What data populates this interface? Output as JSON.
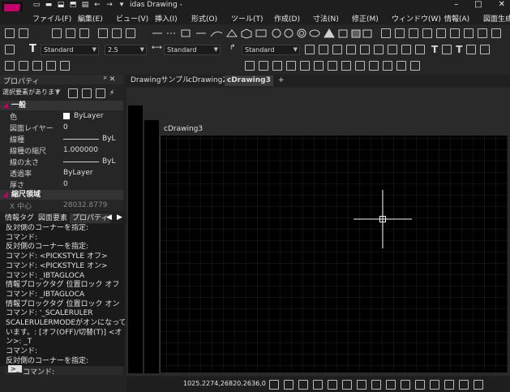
{
  "app": {
    "title": "idas Drawing -",
    "brand_color": "#c4006a"
  },
  "window_controls": [
    "–",
    "□",
    "✕"
  ],
  "quick_access": [
    "new-icon",
    "open-icon",
    "save-icon",
    "save-as-icon",
    "print-icon",
    "undo-icon",
    "redo-icon",
    "dropdown-icon"
  ],
  "menu": [
    "ファイル(F)",
    "編集(E)",
    "ビュー(V)",
    "挿入(I)",
    "形式(O)",
    "ツール(T)",
    "作成(D)",
    "寸法(N)",
    "修正(M)",
    "ウィンドウ(W)",
    "情報(A)",
    "図面生成"
  ],
  "toolbar": {
    "text_style": "Standard",
    "text_height": "2.5",
    "dim_style": "Standard",
    "mleader_style": "Standard"
  },
  "properties": {
    "title": "プロパティ",
    "pin": "ᵖ ✕",
    "selection": "選択要素があります",
    "sections": [
      {
        "name": "一般",
        "rows": [
          {
            "key": "色",
            "value": "ByLayer"
          },
          {
            "key": "図面レイヤー",
            "value": "0"
          },
          {
            "key": "線種",
            "value": "ByL"
          },
          {
            "key": "線種の縮尺",
            "value": "1.000000"
          },
          {
            "key": "線の太さ",
            "value": "ByL"
          },
          {
            "key": "透過率",
            "value": "ByLayer"
          },
          {
            "key": "厚さ",
            "value": "0"
          }
        ]
      },
      {
        "name": "縮尺領域",
        "rows": [
          {
            "key": "X 中心",
            "value": "28032.8779"
          }
        ]
      }
    ]
  },
  "panel_tabs": [
    "情報タグ",
    "図面要素",
    "プロパティ"
  ],
  "console_lines": [
    "反対側のコーナーを指定:",
    "コマンド:",
    "反対側のコーナーを指定:",
    "コマンド: <PICKSTYLE オフ>",
    "コマンド: <PICKSTYLE オン>",
    "コマンド: _IBTAGLOCA",
    "情報ブロックタグ 位置ロック オフ",
    "コマンド: _IBTAGLOCA",
    "情報ブロックタグ 位置ロック オン",
    "コマンド: '_SCALERULER",
    "SCALERULERMODEがオンになって",
    "います。: [オフ(OFF)/切替(T)] <オ",
    "ン>: _T",
    "コマンド:",
    "反対側のコーナーを指定:"
  ],
  "command_prompt": "コマンド:",
  "doc_tabs": [
    "Drawingサンプル",
    "cDrawing2",
    "cDrawing3",
    "+"
  ],
  "active_doc_tab": "cDrawing3",
  "viewport_label": "cDrawing3",
  "status": {
    "coordinates": "1025.2274,26820.2636,0"
  }
}
